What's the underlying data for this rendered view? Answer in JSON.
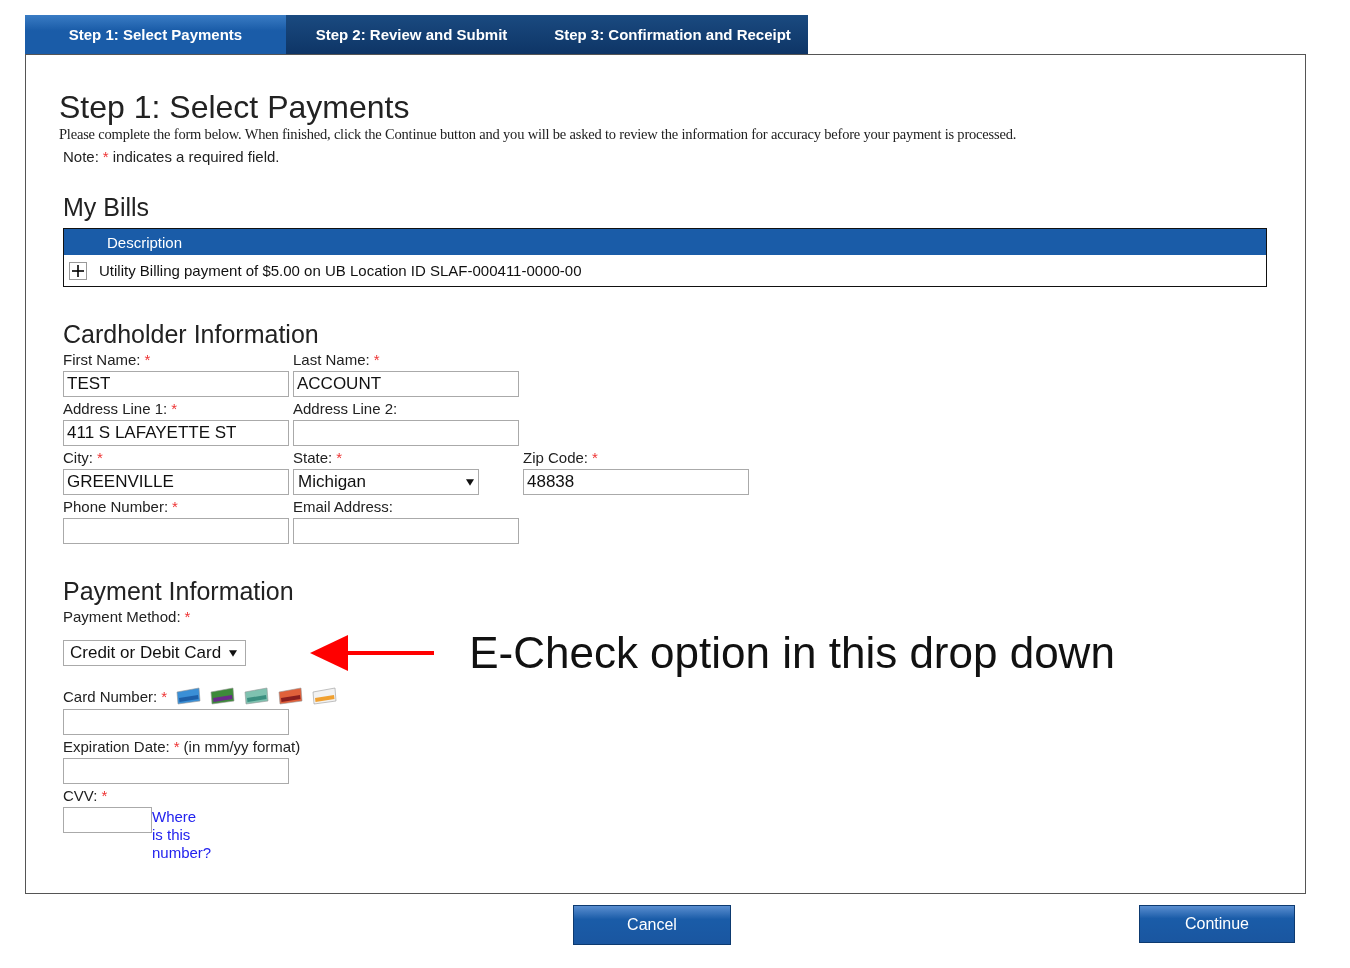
{
  "tabs": [
    {
      "label": "Step 1: Select Payments",
      "selected": true
    },
    {
      "label": "Step 2: Review and Submit",
      "selected": false
    },
    {
      "label": "Step 3: Confirmation and Receipt",
      "selected": false
    }
  ],
  "title": "Step 1: Select Payments",
  "instructions": "Please complete the form below. When finished, click the Continue button and you will be asked to review the information for accuracy before your payment is processed.",
  "note": {
    "before": "Note:",
    "mark": "*",
    "after": "indicates a required field."
  },
  "bills": {
    "heading": "My Bills",
    "columns": [
      "Description"
    ],
    "rows": [
      {
        "description": "Utility Billing payment of $5.00 on UB Location ID SLAF-000411-0000-00",
        "expanded": false
      }
    ]
  },
  "cardholder": {
    "heading": "Cardholder Information",
    "rows": [
      [
        {
          "label": "First Name:",
          "mark": "*",
          "kind": "text",
          "value": "TEST"
        },
        {
          "label": "Last Name:",
          "mark": "*",
          "kind": "text",
          "value": "ACCOUNT"
        }
      ],
      [
        {
          "label": "Address Line 1:",
          "mark": "*",
          "kind": "text",
          "value": "411 S LAFAYETTE ST"
        },
        {
          "label": "Address Line 2:",
          "kind": "text"
        }
      ],
      [
        {
          "label": "City:",
          "mark": "*",
          "kind": "text",
          "value": "GREENVILLE"
        },
        {
          "label": "State:",
          "mark": "*",
          "kind": "select",
          "value": "Michigan"
        },
        {
          "label": "Zip Code:",
          "mark": "*",
          "kind": "text",
          "value": "48838"
        }
      ],
      [
        {
          "label": "Phone Number:",
          "mark": "*",
          "kind": "text"
        },
        {
          "label": "Email Address:",
          "kind": "text"
        }
      ]
    ]
  },
  "payment": {
    "heading": "Payment Information",
    "method": {
      "label": "Payment Method:",
      "mark": "*",
      "value": "Credit or Debit Card"
    },
    "card_number": {
      "label": "Card Number:",
      "mark": "*"
    },
    "expiration": {
      "label": "Expiration Date:",
      "mark": "*",
      "hint": "(in mm/yy format)"
    },
    "cvv": {
      "label": "CVV:",
      "mark": "*",
      "link": "Where is this number?"
    }
  },
  "annotation": "E-Check option in this drop down",
  "buttons": [
    {
      "label": "Cancel"
    },
    {
      "label": "Continue"
    }
  ]
}
